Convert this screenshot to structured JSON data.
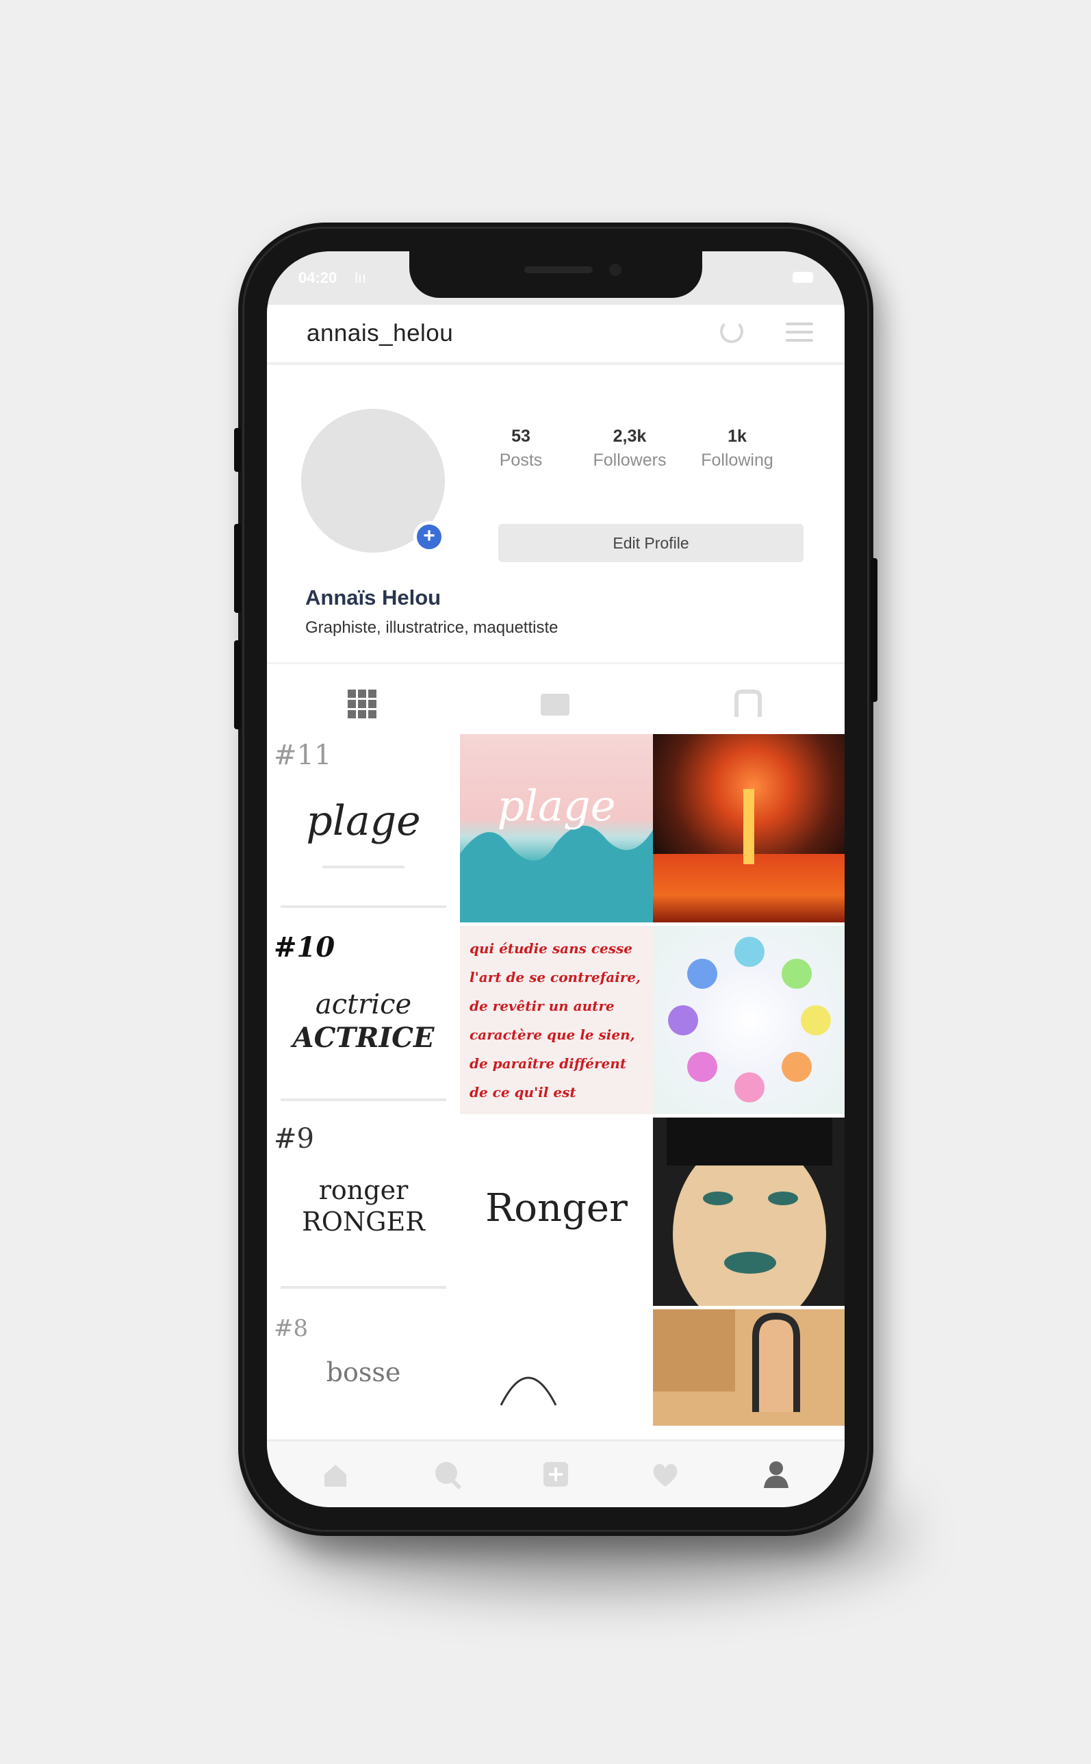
{
  "status": {
    "time": "04:20",
    "signal": "lıı"
  },
  "header": {
    "username": "annais_helou",
    "history_icon": "history-icon",
    "menu_icon": "menu-icon"
  },
  "profile": {
    "stats": [
      {
        "count": "53",
        "label": "Posts"
      },
      {
        "count": "2,3k",
        "label": "Followers"
      },
      {
        "count": "1k",
        "label": "Following"
      }
    ],
    "edit_label": "Edit Profile",
    "name": "Annaïs Helou",
    "bio": "Graphiste, illustratrice, maquettiste"
  },
  "tabs": [
    "grid-icon",
    "tv-icon",
    "tagged-icon"
  ],
  "posts": [
    {
      "id": "#11",
      "text": "plage"
    },
    {
      "id": "",
      "text": "plage"
    },
    {
      "id": "",
      "text": ""
    },
    {
      "id": "#10",
      "text": "actrice",
      "text2": "ACTRICE"
    },
    {
      "id": "",
      "lines": [
        "qui étudie sans cesse",
        "l'art de se contrefaire,",
        "de revêtir un autre",
        "caractère que le sien,",
        "de paraître différent",
        "de ce qu'il est"
      ]
    },
    {
      "id": "",
      "text": ""
    },
    {
      "id": "#9",
      "text": "ronger",
      "text2": "RONGER"
    },
    {
      "id": "",
      "text": "Ronger"
    },
    {
      "id": "",
      "text": ""
    },
    {
      "id": "#8",
      "text": "bosse"
    }
  ],
  "nav": [
    "home-icon",
    "search-icon",
    "add-icon",
    "heart-icon",
    "profile-icon"
  ],
  "colors": {
    "accent": "#3b6fd6",
    "background": "#efefef"
  }
}
